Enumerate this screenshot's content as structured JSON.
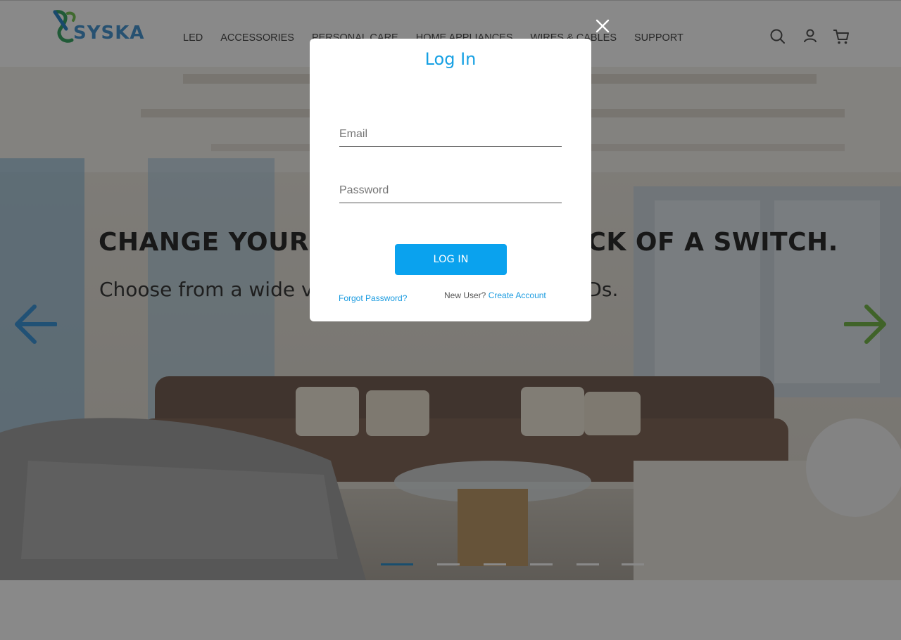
{
  "brand": {
    "logo_text": "SYSKA"
  },
  "nav": {
    "items": [
      {
        "label": "LED"
      },
      {
        "label": "ACCESSORIES"
      },
      {
        "label": "PERSONAL CARE"
      },
      {
        "label": "HOME APPLIANCES"
      },
      {
        "label": "WIRES & CABLES"
      },
      {
        "label": "SUPPORT"
      }
    ]
  },
  "header_icons": [
    "search-icon",
    "user-icon",
    "cart-icon"
  ],
  "hero": {
    "title": "CHANGE YOUR LIGHTS AT THE FLICK OF A SWITCH.",
    "subtitle": "Choose from a wide variety of energy-efficient LEDs.",
    "slides_count": 6,
    "active_slide": 1
  },
  "login_modal": {
    "title": "Log In",
    "email_placeholder": "Email",
    "password_placeholder": "Password",
    "login_button": "LOG IN",
    "forgot_password": "Forgot Password?",
    "new_user_text": "New User?",
    "create_account": "Create Account"
  },
  "colors": {
    "accent_blue": "#0aa2ee",
    "link_blue": "#1a9be0",
    "arrow_left": "#2f8ed6",
    "arrow_right": "#6cb33f",
    "active_dot": "#1e88c8"
  }
}
